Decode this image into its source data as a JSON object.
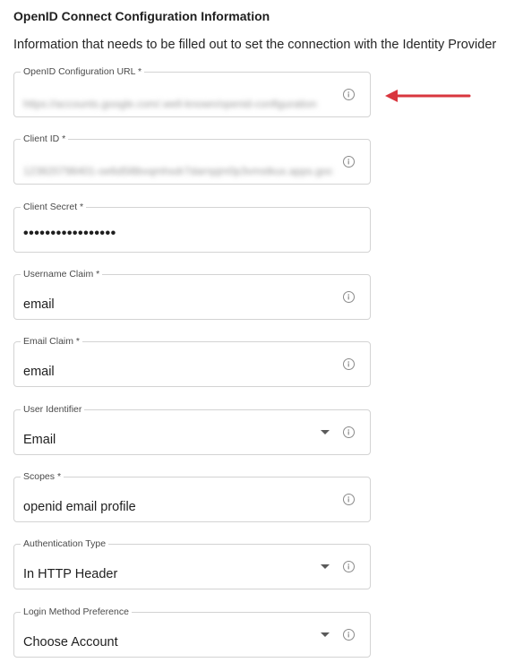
{
  "section": {
    "title": "OpenID Connect Configuration Information",
    "description": "Information that needs to be filled out to set the connection with the Identity Provider"
  },
  "fields": [
    {
      "label": "OpenID Configuration URL *",
      "value": "https://accounts.google.com/.well-known/openid-configuration",
      "blurred": true,
      "icon": "info-icon"
    },
    {
      "label": "Client ID *",
      "value": "123820798401-oe6d5l8bvqmhxdr7darnpjm0p3vmstkux.apps.googleusercontent.com",
      "blurred": true,
      "icon": "info-icon"
    },
    {
      "label": "Client Secret *",
      "value": "•••••••••••••••••",
      "masked": true
    },
    {
      "label": "Username Claim *",
      "value": "email",
      "icon": "info-icon"
    },
    {
      "label": "Email Claim *",
      "value": "email",
      "icon": "info-icon"
    },
    {
      "label": "User Identifier",
      "value": "Email",
      "dropdown": true,
      "icon": "info-icon"
    },
    {
      "label": "Scopes *",
      "value": "openid email profile",
      "icon": "info-icon"
    },
    {
      "label": "Authentication Type",
      "value": "In HTTP Header",
      "dropdown": true,
      "icon": "info-icon"
    },
    {
      "label": "Login Method Preference",
      "value": "Choose Account",
      "dropdown": true,
      "icon": "info-icon"
    }
  ],
  "colors": {
    "annotation_arrow": "#d9363e",
    "field_border": "#d3d3d3",
    "icon": "#8a8a8a"
  }
}
